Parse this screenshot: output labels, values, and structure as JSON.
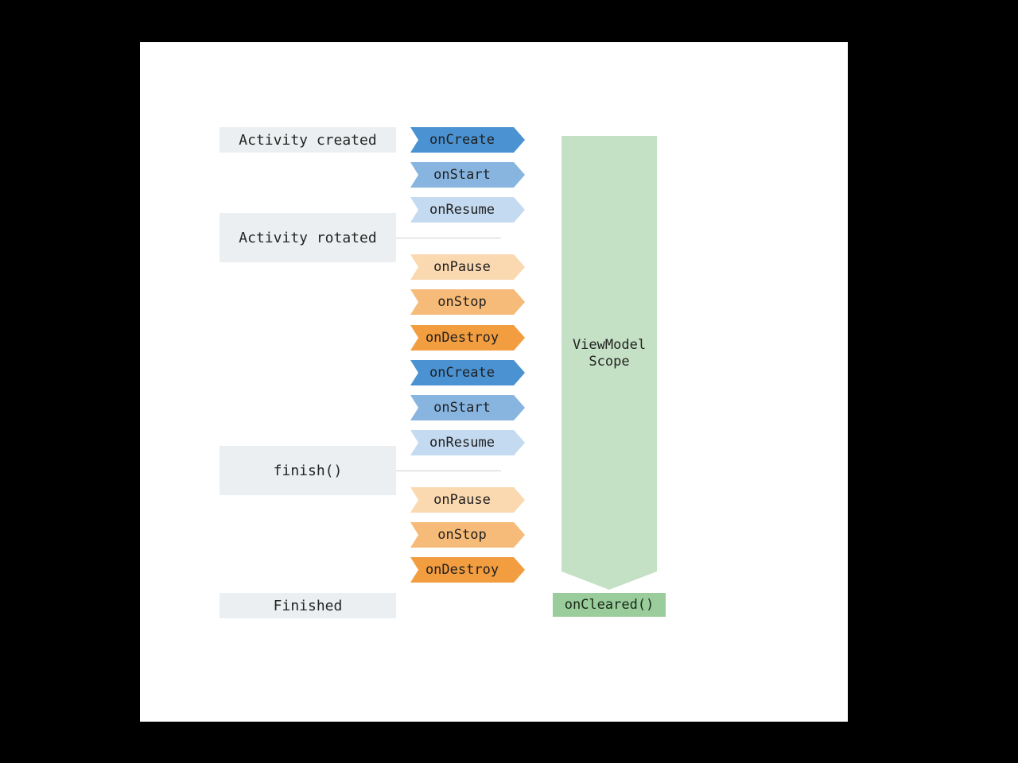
{
  "colors": {
    "state_bg": "#eceff1",
    "onCreate": "#4a92d1",
    "onStart": "#88b5e0",
    "onResume": "#c4daf0",
    "onPause": "#fbd9b0",
    "onStop": "#f6bb78",
    "onDestroy": "#f29d40",
    "scope_body": "#c5e1c5",
    "scope_foot": "#9bcc9b"
  },
  "chart_data": {
    "type": "table",
    "description": "Android Activity lifecycle callbacks alongside ViewModel scope lifetime",
    "rows": [
      {
        "state": "Activity created",
        "callback": "onCreate",
        "viewmodel_alive": true
      },
      {
        "state": "",
        "callback": "onStart",
        "viewmodel_alive": true
      },
      {
        "state": "",
        "callback": "onResume",
        "viewmodel_alive": true
      },
      {
        "state": "Activity rotated",
        "callback": "",
        "viewmodel_alive": true
      },
      {
        "state": "",
        "callback": "onPause",
        "viewmodel_alive": true
      },
      {
        "state": "",
        "callback": "onStop",
        "viewmodel_alive": true
      },
      {
        "state": "",
        "callback": "onDestroy",
        "viewmodel_alive": true
      },
      {
        "state": "",
        "callback": "onCreate",
        "viewmodel_alive": true
      },
      {
        "state": "",
        "callback": "onStart",
        "viewmodel_alive": true
      },
      {
        "state": "",
        "callback": "onResume",
        "viewmodel_alive": true
      },
      {
        "state": "finish()",
        "callback": "",
        "viewmodel_alive": true
      },
      {
        "state": "",
        "callback": "onPause",
        "viewmodel_alive": true
      },
      {
        "state": "",
        "callback": "onStop",
        "viewmodel_alive": true
      },
      {
        "state": "",
        "callback": "onDestroy",
        "viewmodel_alive": true
      },
      {
        "state": "Finished",
        "callback": "",
        "viewmodel_alive": false,
        "viewmodel_event": "onCleared()"
      }
    ]
  },
  "states": {
    "created": "Activity created",
    "rotated": "Activity rotated",
    "finish": "finish()",
    "finished": "Finished"
  },
  "callbacks": {
    "onCreate": "onCreate",
    "onStart": "onStart",
    "onResume": "onResume",
    "onPause": "onPause",
    "onStop": "onStop",
    "onDestroy": "onDestroy"
  },
  "scope": {
    "title_line1": "ViewModel",
    "title_line2": "Scope",
    "cleared": "onCleared()"
  }
}
